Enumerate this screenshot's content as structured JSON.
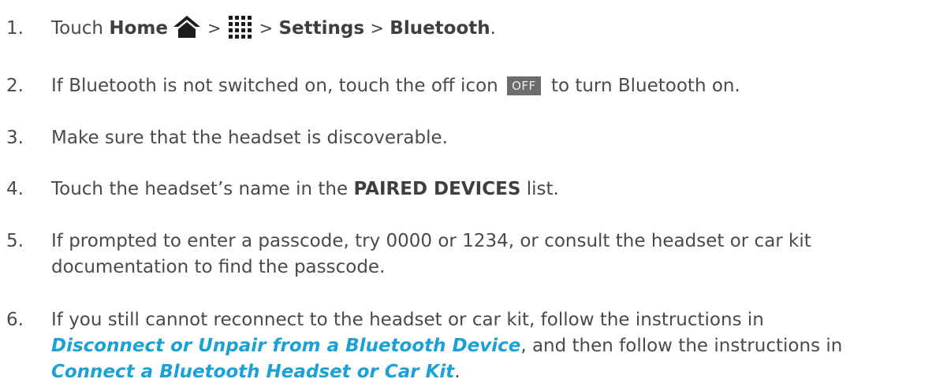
{
  "steps": [
    {
      "number": "1.",
      "pre": "Touch ",
      "home_label": "Home",
      "sep1": ">",
      "sep2": ">",
      "settings_label": "Settings",
      "sep3": ">",
      "bluetooth_label": "Bluetooth",
      "end": ".",
      "icons": [
        "home-icon",
        "apps-grid-icon"
      ]
    },
    {
      "number": "2.",
      "pre": "If Bluetooth is not switched on, touch the off icon",
      "badge": "OFF",
      "post": "to turn Bluetooth on."
    },
    {
      "number": "3.",
      "text": "Make sure that the headset is discoverable."
    },
    {
      "number": "4.",
      "pre": "Touch the headset’s name in the ",
      "bold": "PAIRED DEVICES",
      "post": " list."
    },
    {
      "number": "5.",
      "line1": "If prompted to enter a passcode, try 0000 or 1234, or consult the headset or car kit",
      "line2": "documentation to find the passcode."
    },
    {
      "number": "6.",
      "line1": "If you still cannot reconnect to the headset or car kit, follow the instructions in",
      "link1": "Disconnect or Unpair from a Bluetooth Device",
      "line2_post": ", and then follow the instructions in",
      "link2": "Connect a Bluetooth Headset or Car Kit",
      "line3_post": "."
    }
  ],
  "colors": {
    "text": "#4a4a4a",
    "link": "#1ba1d6",
    "badge_bg": "#6c6c6c"
  }
}
